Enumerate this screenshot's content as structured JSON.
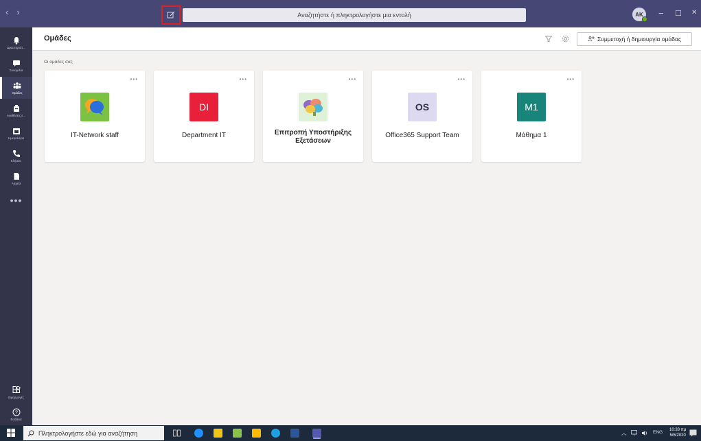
{
  "titlebar": {
    "nav_back": "‹",
    "nav_forward": "›",
    "search_placeholder": "Αναζητήστε ή πληκτρολογήστε μια εντολή",
    "avatar_initials": "AK",
    "minimize": "−",
    "maximize": "☐",
    "close": "✕"
  },
  "rail": {
    "items": [
      {
        "label": "Δραστηριότ...",
        "icon": "bell-icon"
      },
      {
        "label": "Συνομιλία",
        "icon": "chat-icon"
      },
      {
        "label": "Ομάδες",
        "icon": "teams-icon",
        "active": true
      },
      {
        "label": "Αναθέσεις ε...",
        "icon": "assignments-icon"
      },
      {
        "label": "Ημερολόγιο",
        "icon": "calendar-icon"
      },
      {
        "label": "Κλήσεις",
        "icon": "phone-icon"
      },
      {
        "label": "Αρχεία",
        "icon": "files-icon"
      }
    ],
    "more": "•••",
    "apps_label": "Εφαρμογές",
    "help_label": "Βοήθεια"
  },
  "main": {
    "title": "Ομάδες",
    "join_button": "Συμμετοχή ή δημιουργία ομάδας",
    "section_label": "Οι ομάδες σας",
    "teams": [
      {
        "name": "IT-Network staff",
        "tile": "",
        "tile_color": "#7cc242",
        "kind": "chat-logo",
        "bold": false
      },
      {
        "name": "Department IT",
        "tile": "DI",
        "tile_color": "#e8203a",
        "text_color": "#ffffff",
        "bold": false
      },
      {
        "name": "Επιτροπή Υποστήριξης Εξετάσεων",
        "tile": "",
        "tile_color": "#dff2d8",
        "kind": "brain-logo",
        "bold": true
      },
      {
        "name": "Office365 Support Team",
        "tile": "OS",
        "tile_color": "#dcd9f0",
        "text_color": "#33344a",
        "bold": false
      },
      {
        "name": "Μάθημα 1",
        "tile": "M1",
        "tile_color": "#17857a",
        "text_color": "#ffffff",
        "bold": false
      }
    ],
    "card_more": "•••"
  },
  "taskbar": {
    "search_placeholder": "Πληκτρολογήστε εδώ για αναζήτηση",
    "language": "ENG",
    "time": "10:33 πμ",
    "date": "5/6/2020"
  }
}
